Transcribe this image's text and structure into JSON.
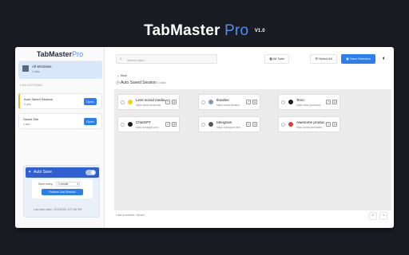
{
  "promo": {
    "title_main": "TabMaster",
    "title_pro": "Pro",
    "version": "V1.0"
  },
  "sidebar": {
    "logo_main": "TabMaster",
    "logo_pro": "Pro",
    "all_windows": {
      "label": "All Windows",
      "sub": "1 tabs"
    },
    "collections_heading": "COLLECTIONS",
    "collections": [
      {
        "name": "Auto Saved Session",
        "count": "6 tabs",
        "open": "Open"
      },
      {
        "name": "Saved Tab",
        "count": "0 tabs",
        "open": "Open"
      }
    ],
    "auto_save": {
      "label": "Auto Save",
      "save_every_label": "Save every:",
      "save_every_value": "1 minute",
      "restore_button": "Restore Last Session",
      "last_auto_save": "Last auto-save: 2/12/2025, 4:07:56 PM"
    }
  },
  "toolbar": {
    "search_placeholder": "Search tabs...",
    "all_tabs": "All Tabs",
    "select_all": "Select All",
    "save_selected": "Save Selected"
  },
  "session": {
    "back": "← Back",
    "title": "Auto Saved Session",
    "count": "6 tabs"
  },
  "tabs": [
    {
      "title": "Less social media...",
      "url": "https://www.snapchat...",
      "favicon_color": "#f7d21a"
    },
    {
      "title": "Ikealine",
      "url": "https://www.ikealine...",
      "favicon_color": "#8899aa"
    },
    {
      "title": "Tevo",
      "url": "https://tevo.gumroad...",
      "favicon_color": "#1b1b1b"
    },
    {
      "title": "ChatGPT",
      "url": "https://chatgpt.com/",
      "favicon_color": "#1b1b1b"
    },
    {
      "title": "Ideogram",
      "url": "https://ideogram.ai/t/...",
      "favicon_color": "#555555"
    },
    {
      "title": "Awesome produc...",
      "url": "https://www.webulabs...",
      "favicon_color": "#e53935"
    }
  ],
  "footer": {
    "last_autosave": "Last autosave: Never"
  },
  "colors": {
    "accent": "#2a7ef0",
    "autosave_bar": "#2f5fd0",
    "active_border": "#f0b429"
  }
}
